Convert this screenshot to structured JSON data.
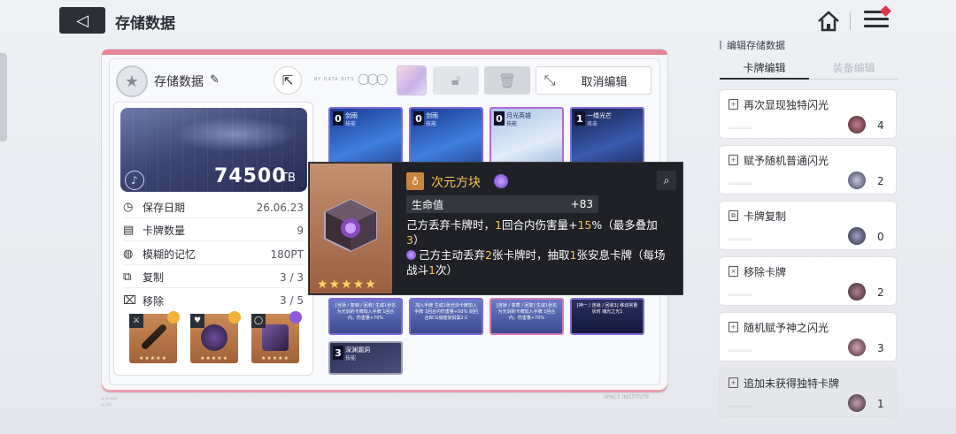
{
  "header": {
    "title": "存储数据",
    "back_icon": "◁"
  },
  "panel": {
    "title": "存储数据",
    "cancel_label": "取消编辑",
    "tiny_text": "BY DATA BITS"
  },
  "banner": {
    "value": "74500",
    "unit": "TB"
  },
  "stats": [
    {
      "icon": "clock-icon",
      "glyph": "◷",
      "label": "保存日期",
      "value": "26.06.23"
    },
    {
      "icon": "cards-icon",
      "glyph": "▤",
      "label": "卡牌数量",
      "value": "9"
    },
    {
      "icon": "memory-icon",
      "glyph": "◍",
      "label": "模糊的记忆",
      "value": "180PT"
    },
    {
      "icon": "copy-icon",
      "glyph": "⧉",
      "label": "复制",
      "value": "3 / 3"
    },
    {
      "icon": "remove-icon",
      "glyph": "⌧",
      "label": "移除",
      "value": "3 / 5"
    }
  ],
  "equipment": [
    {
      "tag": "⚔",
      "stars": "★★★★★",
      "badge_color": "#f3b13a"
    },
    {
      "tag": "♥",
      "stars": "★★★★★",
      "badge_color": "#f3b13a"
    },
    {
      "tag": "◯",
      "stars": "★★★★★",
      "badge_color": "#8f5ad8"
    }
  ],
  "cards_top": [
    {
      "cost": "0",
      "name": "剑雨",
      "sub": "技能"
    },
    {
      "cost": "0",
      "name": "剑雨",
      "sub": "技能"
    },
    {
      "cost": "0",
      "name": "月光英雄",
      "sub": "技能"
    },
    {
      "cost": "1",
      "name": "一缕光芒",
      "sub": "攻击"
    }
  ],
  "cards_bottom": [
    {
      "text": "[当场 / 复制 / 回收] 生成1张名为光剑的卡牌加入手牌 1回合内，伤害量+70%"
    },
    {
      "text": "加入手牌 生成1张光剑卡牌加入手牌 1回合内伤害量+50% 剑回合BCG接能受损需2:1"
    },
    {
      "text": "[连锁 / 变质 / 回复] 生成1张名为光剑的卡牌加入手牌 1回合内，伤害量+70%"
    },
    {
      "text": "[神一 / 连锁 / 回收3] 移动常量状时 魂光之光1"
    }
  ],
  "card_last": {
    "cost": "3",
    "name": "深渊漏洞",
    "sub": "技能"
  },
  "tooltip": {
    "name": "次元方块",
    "stars": "★★★★★",
    "stat_label": "生命值",
    "stat_value": "+83",
    "desc1_a": "己方丢弃卡牌时，",
    "desc1_b": "1",
    "desc1_c": "回合内伤害量+",
    "desc1_d": "15",
    "desc1_e": "%（最多叠加",
    "desc1_f": "3",
    "desc1_g": "）",
    "desc2_a": "己方主动丢弃",
    "desc2_b": "2",
    "desc2_c": "张卡牌时，抽取",
    "desc2_d": "1",
    "desc2_e": "张安息卡牌（每场战斗",
    "desc2_f": "1",
    "desc2_g": "次）"
  },
  "right_panel": {
    "title": "编辑存储数据",
    "tab_active": "卡牌编辑",
    "tab_inactive": "装备编辑",
    "items": [
      {
        "label": "再次显现独特闪光",
        "count": "4",
        "orb_color": "#6a3440"
      },
      {
        "label": "赋予随机普通闪光",
        "count": "2",
        "orb_color": "#5c5f74"
      },
      {
        "label": "卡牌复制",
        "count": "0",
        "orb_color": "#4d4f63"
      },
      {
        "label": "移除卡牌",
        "count": "2",
        "orb_color": "#58404a"
      },
      {
        "label": "随机赋予神之闪光",
        "count": "3",
        "orb_color": "#6b4a55"
      },
      {
        "label": "追加未获得独特卡牌",
        "count": "1",
        "orb_color": "#5a4a55"
      }
    ]
  },
  "watermark_right": "SPACE INSTITUTE"
}
